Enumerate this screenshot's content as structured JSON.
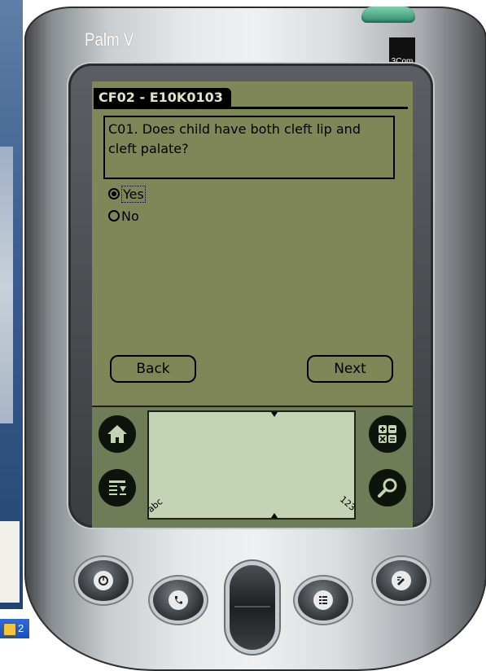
{
  "device": {
    "brand": "Palm V",
    "manufacturer_logo": "3Com"
  },
  "form": {
    "title": "CF02 - E10K0103",
    "question": "C01. Does child have both cleft lip and cleft palate?",
    "options": [
      {
        "label": "Yes",
        "selected": true
      },
      {
        "label": "No",
        "selected": false
      }
    ],
    "back_label": "Back",
    "next_label": "Next"
  },
  "graffiti": {
    "alpha_label": "abc",
    "numeric_label": "123"
  },
  "silkscreen_icons": [
    "home-icon",
    "menu-icon",
    "calculator-icon",
    "find-icon"
  ],
  "hardware_buttons": [
    "date-book-icon",
    "phone-book-icon",
    "todo-list-icon",
    "memo-pad-icon"
  ],
  "taskbar": {
    "chip_text": "2"
  },
  "colors": {
    "screen_bg": "#7f8759",
    "graffiti_bg": "#c4d3b3",
    "title_bar": "#000000",
    "accent_green_button": "#3fa07a"
  }
}
